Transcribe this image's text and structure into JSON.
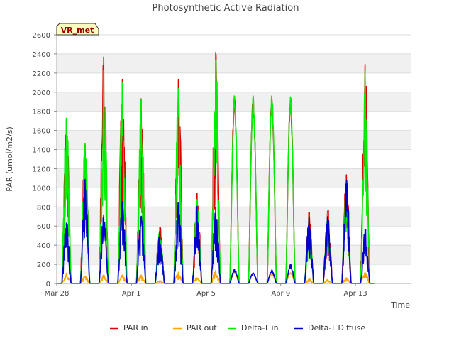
{
  "chart_data": {
    "type": "line",
    "title": "Photosynthetic Active Radiation",
    "xlabel": "Time",
    "ylabel": "PAR (umol/m2/s)",
    "badge": "VR_met",
    "xlim": [
      "2025-03-28",
      "2025-04-16"
    ],
    "ylim": [
      0,
      2600
    ],
    "yticks": [
      0,
      200,
      400,
      600,
      800,
      1000,
      1200,
      1400,
      1600,
      1800,
      2000,
      2200,
      2400,
      2600
    ],
    "xticks": [
      {
        "date": "2025-03-28",
        "label": "Mar 28"
      },
      {
        "date": "2025-04-01",
        "label": "Apr 1"
      },
      {
        "date": "2025-04-05",
        "label": "Apr 5"
      },
      {
        "date": "2025-04-09",
        "label": "Apr 9"
      },
      {
        "date": "2025-04-13",
        "label": "Apr 13"
      }
    ],
    "grid": true,
    "legend_position": "bottom",
    "days": [
      {
        "date": "2025-03-28",
        "par_in": 1780,
        "par_out": 110,
        "delta_t_in": 1780,
        "diffuse": 650
      },
      {
        "date": "2025-03-29",
        "par_in": 1510,
        "par_out": 80,
        "delta_t_in": 1510,
        "diffuse": 1120
      },
      {
        "date": "2025-03-30",
        "par_in": 2440,
        "par_out": 90,
        "delta_t_in": 2300,
        "diffuse": 740
      },
      {
        "date": "2025-03-31",
        "par_in": 2200,
        "par_out": 90,
        "delta_t_in": 2170,
        "diffuse": 880
      },
      {
        "date": "2025-04-01",
        "par_in": 1990,
        "par_out": 90,
        "delta_t_in": 1980,
        "diffuse": 720
      },
      {
        "date": "2025-04-02",
        "par_in": 600,
        "par_out": 30,
        "delta_t_in": 580,
        "diffuse": 560
      },
      {
        "date": "2025-04-03",
        "par_in": 2200,
        "par_out": 120,
        "delta_t_in": 2100,
        "diffuse": 860
      },
      {
        "date": "2025-04-04",
        "par_in": 970,
        "par_out": 60,
        "delta_t_in": 900,
        "diffuse": 830
      },
      {
        "date": "2025-04-05",
        "par_in": 2490,
        "par_out": 140,
        "delta_t_in": 2400,
        "diffuse": 820
      },
      {
        "date": "2025-04-06",
        "par_in": 1960,
        "par_out": 120,
        "delta_t_in": 1960,
        "diffuse": 150
      },
      {
        "date": "2025-04-07",
        "par_in": 1960,
        "par_out": 110,
        "delta_t_in": 1960,
        "diffuse": 110
      },
      {
        "date": "2025-04-08",
        "par_in": 1960,
        "par_out": 100,
        "delta_t_in": 1960,
        "diffuse": 140
      },
      {
        "date": "2025-04-09",
        "par_in": 1950,
        "par_out": 110,
        "delta_t_in": 1950,
        "diffuse": 200
      },
      {
        "date": "2025-04-10",
        "par_in": 760,
        "par_out": 50,
        "delta_t_in": 740,
        "diffuse": 720
      },
      {
        "date": "2025-04-11",
        "par_in": 780,
        "par_out": 40,
        "delta_t_in": 760,
        "diffuse": 720
      },
      {
        "date": "2025-04-12",
        "par_in": 1170,
        "par_out": 60,
        "delta_t_in": 1100,
        "diffuse": 1100
      },
      {
        "date": "2025-04-13",
        "par_in": 2360,
        "par_out": 120,
        "delta_t_in": 2290,
        "diffuse": 580
      }
    ],
    "series": [
      {
        "key": "par_in",
        "name": "PAR in",
        "color": "#dd0000"
      },
      {
        "key": "par_out",
        "name": "PAR out",
        "color": "#ffa500"
      },
      {
        "key": "delta_t_in",
        "name": "Delta-T in",
        "color": "#00ee00"
      },
      {
        "key": "diffuse",
        "name": "Delta-T Diffuse",
        "color": "#0000cc"
      }
    ]
  }
}
